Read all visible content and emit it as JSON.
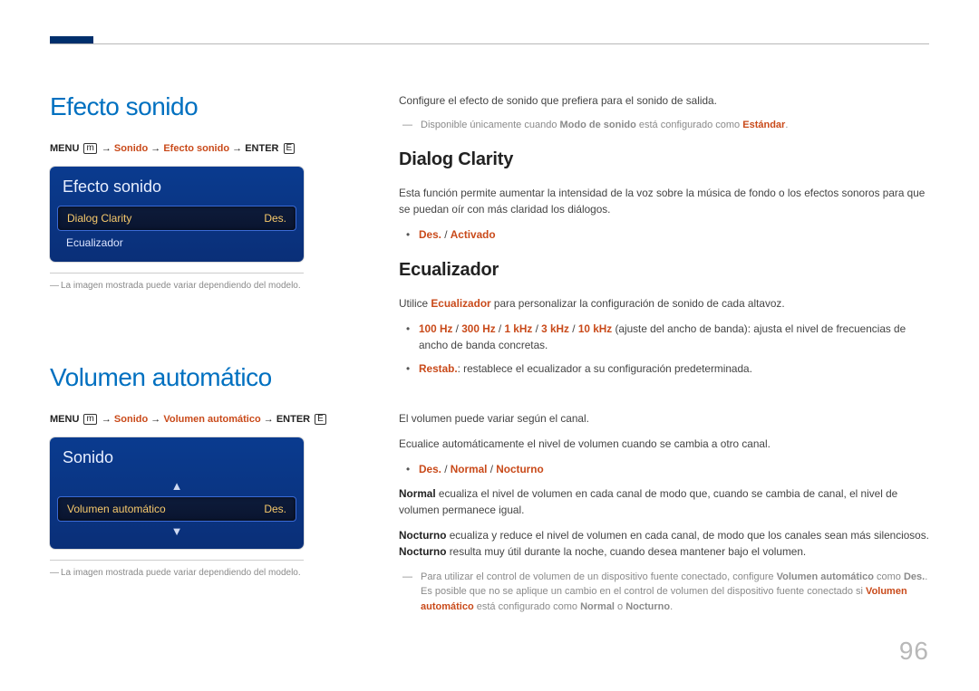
{
  "page_number": "96",
  "left": {
    "h1_effect": "Efecto sonido",
    "crumb_effect": {
      "menu": "MENU",
      "path1": "Sonido",
      "path2": "Efecto sonido",
      "enter": "ENTER"
    },
    "osd_effect": {
      "title": "Efecto sonido",
      "rows": [
        {
          "label": "Dialog Clarity",
          "val": "Des."
        },
        {
          "label": "Ecualizador",
          "val": ""
        }
      ]
    },
    "caption": "La imagen mostrada puede variar dependiendo del modelo.",
    "h1_volume": "Volumen automático",
    "crumb_volume": {
      "menu": "MENU",
      "path1": "Sonido",
      "path2": "Volumen automático",
      "enter": "ENTER"
    },
    "osd_volume": {
      "title": "Sonido",
      "row": {
        "label": "Volumen automático",
        "val": "Des."
      }
    }
  },
  "right": {
    "intro": "Configure el efecto de sonido que prefiera para el sonido de salida.",
    "note_intro_pre": "Disponible únicamente cuando ",
    "note_intro_b": "Modo de sonido",
    "note_intro_mid": " está configurado como ",
    "note_intro_accent": "Estándar",
    "note_intro_post": ".",
    "h2_dialog": "Dialog Clarity",
    "dialog_p": "Esta función permite aumentar la intensidad de la voz sobre la música de fondo o los efectos sonoros para que se puedan oír con más claridad los diálogos.",
    "dialog_opts_des": "Des.",
    "dialog_opts_sep": " / ",
    "dialog_opts_act": "Activado",
    "h2_eq": "Ecualizador",
    "eq_p_pre": "Utilice ",
    "eq_p_b": "Ecualizador",
    "eq_p_post": " para personalizar la configuración de sonido de cada altavoz.",
    "eq_bands_pre": "",
    "eq_bands": [
      "100 Hz",
      "300 Hz",
      "1 kHz",
      "3 kHz",
      "10 kHz"
    ],
    "eq_bands_post": " (ajuste del ancho de banda): ajusta el nivel de frecuencias de ancho de banda concretas.",
    "eq_reset_b": "Restab.",
    "eq_reset_post": ": restablece el ecualizador a su configuración predeterminada.",
    "vol_p1": "El volumen puede variar según el canal.",
    "vol_p2": "Ecualice automáticamente el nivel de volumen cuando se cambia a otro canal.",
    "vol_opts": [
      "Des.",
      "Normal",
      "Nocturno"
    ],
    "vol_sep": " / ",
    "vol_normal_b": "Normal",
    "vol_normal_post": " ecualiza el nivel de volumen en cada canal de modo que, cuando se cambia de canal, el nivel de volumen permanece igual.",
    "vol_noct_b": "Nocturno",
    "vol_noct_mid": " ecualiza y reduce el nivel de volumen en cada canal, de modo que los canales sean más silenciosos. ",
    "vol_noct_b2": "Nocturno",
    "vol_noct_post": " resulta muy útil durante la noche, cuando desea mantener bajo el volumen.",
    "vol_note_pre": "Para utilizar el control de volumen de un dispositivo fuente conectado, configure ",
    "vol_note_b1": "Volumen automático",
    "vol_note_mid1": " como ",
    "vol_note_b2": "Des.",
    "vol_note_mid2": ".  Es posible que no se aplique un cambio en el control de volumen del dispositivo fuente conectado si ",
    "vol_note_b3": "Volumen automático",
    "vol_note_mid3": " está configurado como ",
    "vol_note_b4": "Normal",
    "vol_note_mid4": " o ",
    "vol_note_b5": "Nocturno",
    "vol_note_post": "."
  }
}
